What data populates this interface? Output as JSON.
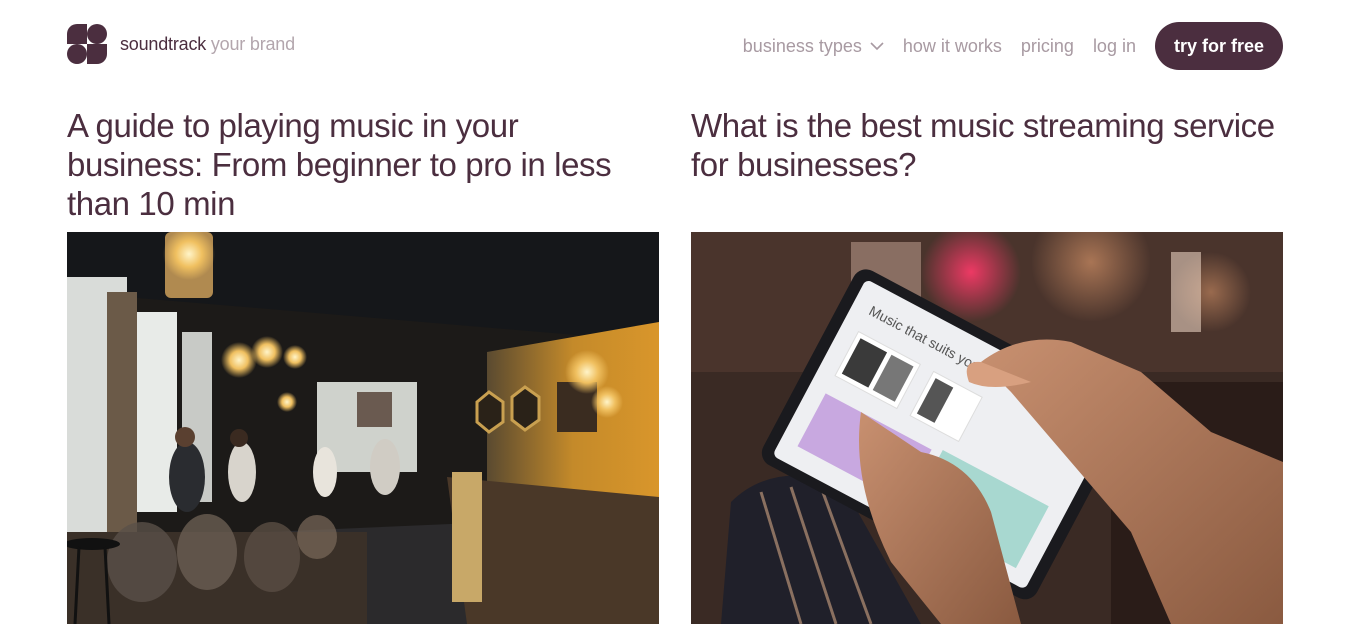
{
  "logo": {
    "brand": "soundtrack",
    "tagline": "your brand",
    "icon": "soundtrack-logo-mark"
  },
  "nav": {
    "items": [
      {
        "label": "business types",
        "icon": "chevron-down-icon"
      },
      {
        "label": "how it works"
      },
      {
        "label": "pricing"
      },
      {
        "label": "log in"
      }
    ],
    "cta": "try for free"
  },
  "articles": [
    {
      "title": "A guide to playing music in your business: From beginner to pro in less than 10 min",
      "image": "cafe-interior-photo"
    },
    {
      "title": "What is the best music streaming service for businesses?",
      "image": "hands-holding-tablet-photo"
    }
  ],
  "tablet_screen": {
    "heading": "Music that suits your"
  },
  "colors": {
    "brand": "#4b2e3f",
    "nav_text": "#a89aa2",
    "tagline": "#b3a6ad"
  }
}
